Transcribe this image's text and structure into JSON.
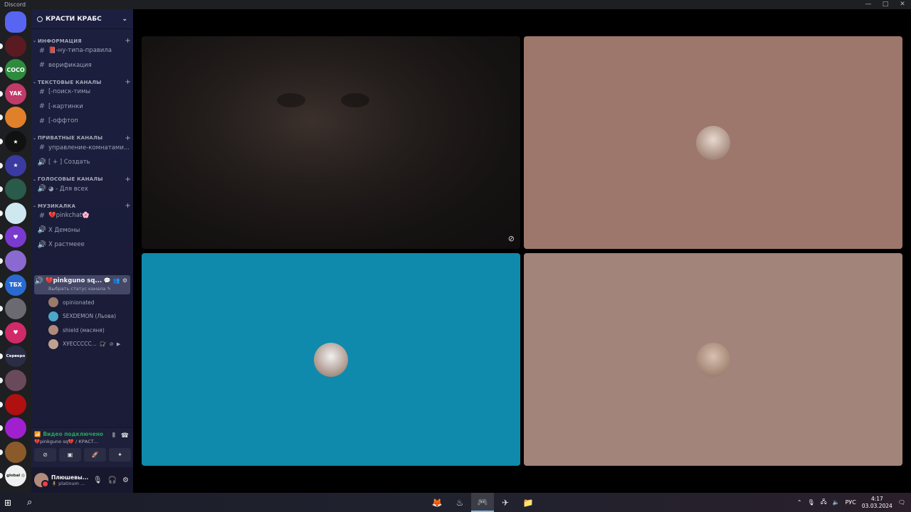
{
  "window": {
    "title": "Discord",
    "controls": [
      "—",
      "□",
      "✕"
    ]
  },
  "server": {
    "name": "КРАСТИ КРАБС"
  },
  "guilds": [
    {
      "label": "",
      "color": "#5865f2",
      "kind": "home"
    },
    {
      "label": "",
      "color": "#5a1a22"
    },
    {
      "label": "COCO",
      "color": "#2e8b3e"
    },
    {
      "label": "YAK",
      "color": "#c03a6a"
    },
    {
      "label": "",
      "color": "#e0802a"
    },
    {
      "label": "★",
      "color": "#111111"
    },
    {
      "label": "★",
      "color": "#3a3aa0"
    },
    {
      "label": "",
      "color": "#2a5a4a"
    },
    {
      "label": "",
      "color": "#cfe8f0"
    },
    {
      "label": "♥",
      "color": "#7a3ad0"
    },
    {
      "label": "",
      "color": "#8a6ad0"
    },
    {
      "label": "ТБХ",
      "color": "#2a6ad0"
    },
    {
      "label": "",
      "color": "#6a6a70"
    },
    {
      "label": "♥",
      "color": "#d02a6a"
    },
    {
      "label": "Серверо",
      "color": "#2b2d45"
    },
    {
      "label": "",
      "color": "#6a4a5a"
    },
    {
      "label": "",
      "color": "#b01010"
    },
    {
      "label": "",
      "color": "#a020d0"
    },
    {
      "label": "",
      "color": "#8a5a2a"
    },
    {
      "label": "global ◎",
      "color": "#f0f0f0"
    }
  ],
  "categories": [
    {
      "name": "ИНФОРМАЦИЯ",
      "channels": [
        {
          "icon": "text",
          "name": "📕-ну-типа-правила"
        },
        {
          "icon": "text",
          "name": "верификация"
        }
      ]
    },
    {
      "name": "ТЕКСТОВЫЕ КАНАЛЫ",
      "channels": [
        {
          "icon": "text",
          "name": "[-поиск-тимы"
        },
        {
          "icon": "text",
          "name": "[-картинки"
        },
        {
          "icon": "text",
          "name": "[-оффтоп"
        }
      ]
    },
    {
      "name": "ПРИВАТНЫЕ КАНАЛЫ",
      "channels": [
        {
          "icon": "text",
          "name": "управление-комнатами..."
        },
        {
          "icon": "voice",
          "name": "[ + ] Создать"
        }
      ]
    },
    {
      "name": "ГОЛОСОВЫЕ КАНАЛЫ",
      "channels": [
        {
          "icon": "voice",
          "name": "◕ - Для всех"
        }
      ]
    },
    {
      "name": "МУЗИКАЛКА",
      "channels": [
        {
          "icon": "text",
          "name": "💔pinkchat🌸"
        },
        {
          "icon": "voice",
          "name": "X Демоны"
        },
        {
          "icon": "voice",
          "name": "X растмеее"
        }
      ]
    }
  ],
  "active_channel": {
    "name": "💔pinkguno sq...",
    "status_hint": "Выбрать статус канала ✎"
  },
  "voice_users": [
    {
      "name": "opinionated",
      "state": "",
      "avatar_color": "#9a7a6a"
    },
    {
      "name": "SEXDEMON (Льова)",
      "state": "",
      "avatar_color": "#4aa8c8"
    },
    {
      "name": "shield (масяня)",
      "state": "",
      "avatar_color": "#b08a78"
    },
    {
      "name": "ХУЕССССС...",
      "state": "🎧̸ ⊘ ▶",
      "avatar_color": "#c0a090"
    }
  ],
  "voice_panel": {
    "status": "Видео подключено",
    "channel": "💔pinkguno sq💔 / КРАСТ...",
    "buttons": [
      "⊘",
      "▣",
      "🚀",
      "✦"
    ]
  },
  "user": {
    "name": "Плюшевы...",
    "status": "🧍 platinum ..."
  },
  "tiles": [
    {
      "kind": "camera",
      "bg": "#1a1514"
    },
    {
      "kind": "avatar",
      "bg": "#9e776c",
      "avatar_color": "#e8d8d0"
    },
    {
      "kind": "avatar",
      "bg": "#0f8aad",
      "avatar_color": "#f0f0f0"
    },
    {
      "kind": "avatar",
      "bg": "#a3847a",
      "avatar_color": "#d8c0b0"
    }
  ],
  "taskbar": {
    "apps": [
      "firefox",
      "steam",
      "discord",
      "telegram",
      "explorer"
    ],
    "lang": "РУС",
    "time": "4:17",
    "date": "03.03.2024"
  }
}
